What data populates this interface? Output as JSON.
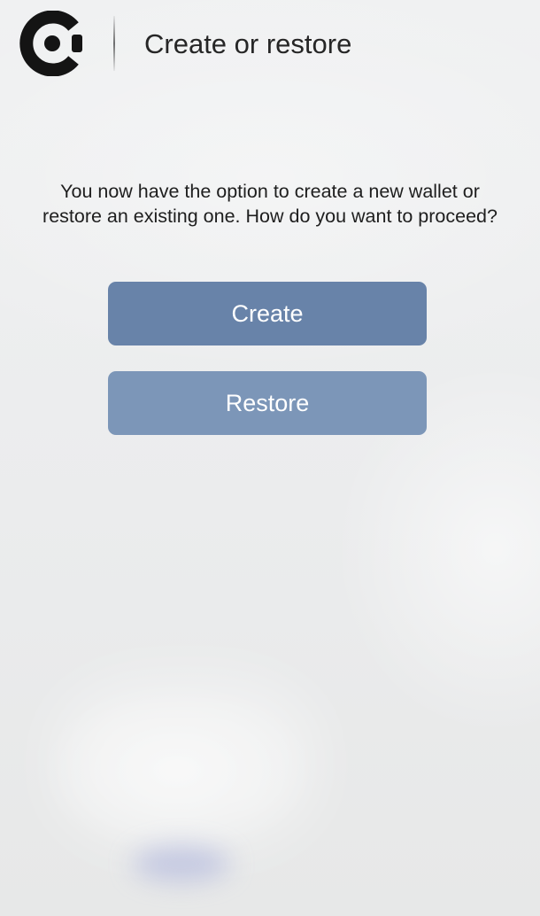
{
  "header": {
    "logo_icon": "app-logo-icon",
    "title": "Create or restore"
  },
  "main": {
    "description_line1": "You now have the option to create a new wallet or",
    "description_line2": "restore an existing one. How do you want to proceed?",
    "create_label": "Create",
    "restore_label": "Restore"
  },
  "colors": {
    "create_button": "#6883a9",
    "restore_button": "#7c96b8",
    "background": "#eeeff0",
    "text": "#1e1e1e"
  }
}
